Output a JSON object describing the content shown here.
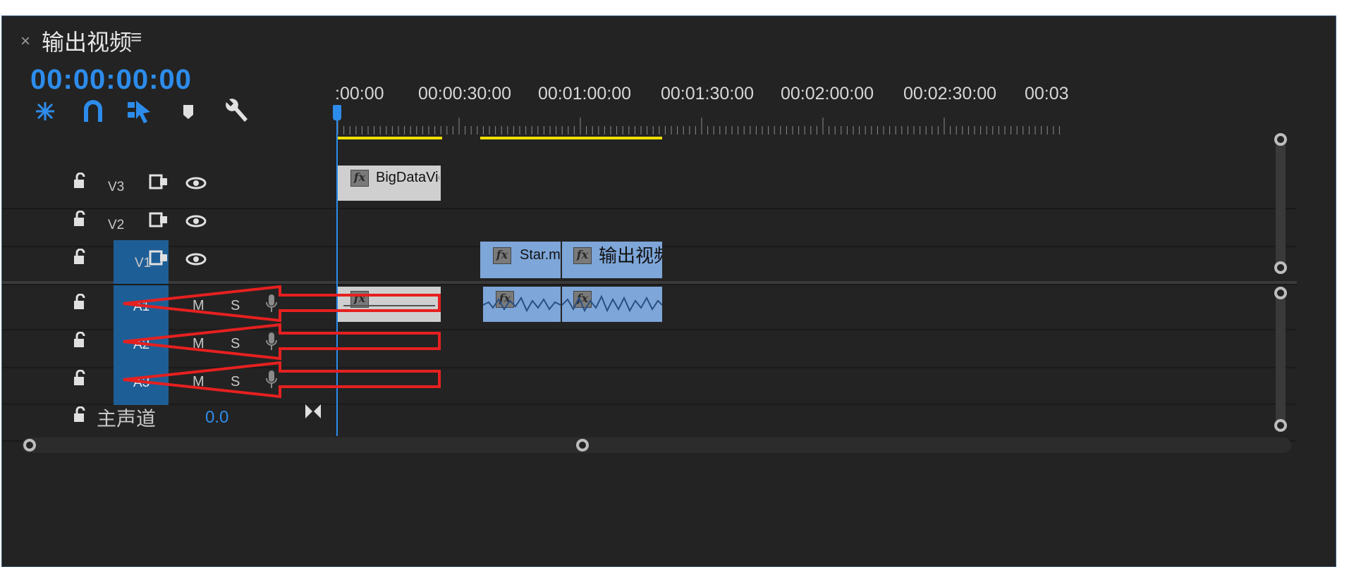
{
  "panel": {
    "title": "输出视频",
    "close_icon": "×",
    "menu_icon": "≡"
  },
  "timecode": "00:00:00:00",
  "toolbar": {
    "icons": [
      "insert-sequence-icon",
      "snap-icon",
      "linked-selection-icon",
      "add-marker-icon",
      "settings-wrench-icon"
    ]
  },
  "ruler": {
    "labels": [
      ":00:00",
      "00:00:30:00",
      "00:01:00:00",
      "00:01:30:00",
      "00:02:00:00",
      "00:02:30:00",
      "00:03"
    ]
  },
  "tracks": {
    "video": [
      {
        "name": "V3",
        "targeted": false
      },
      {
        "name": "V2",
        "targeted": false
      },
      {
        "name": "V1",
        "targeted": true
      }
    ],
    "audio": [
      {
        "name": "A1",
        "mute": "M",
        "solo": "S"
      },
      {
        "name": "A2",
        "mute": "M",
        "solo": "S"
      },
      {
        "name": "A3",
        "mute": "M",
        "solo": "S"
      }
    ],
    "master": {
      "name": "主声道",
      "value": "0.0"
    }
  },
  "clips": {
    "v3": {
      "label": "BigDataVid"
    },
    "v1_a": {
      "label": "Star.mp"
    },
    "v1_b": {
      "label": "输出视频"
    }
  },
  "colors": {
    "accent_blue": "#2d8ceb",
    "target_blue": "#1e5e96",
    "clip_blue": "#7ea6d8",
    "clip_gray": "#cfcfcf",
    "work_area_yellow": "#f0e000",
    "annotation_red": "#e62020"
  }
}
